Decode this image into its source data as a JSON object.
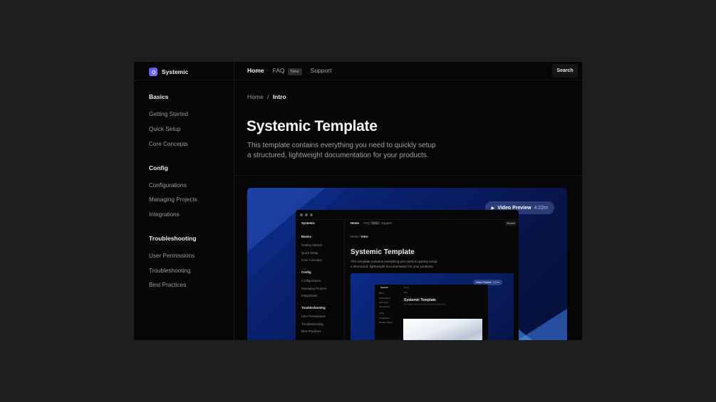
{
  "app": {
    "name": "Systemic"
  },
  "topnav": {
    "home": "Home",
    "faq": "FAQ",
    "faq_badge": "New",
    "support": "Support",
    "search": "Search"
  },
  "sidebar": {
    "groups": [
      {
        "title": "Basics",
        "items": [
          "Getting Started",
          "Quick Setup",
          "Core Concepts"
        ]
      },
      {
        "title": "Config",
        "items": [
          "Configurations",
          "Managing Projects",
          "Integrations"
        ]
      },
      {
        "title": "Troubleshooting",
        "items": [
          "User Permissions",
          "Troubleshooting",
          "Best Practices"
        ]
      }
    ]
  },
  "breadcrumb": {
    "root": "Home",
    "separator": "/",
    "current": "Intro"
  },
  "page": {
    "title": "Systemic Template",
    "description_line1": "This template contains everything you need to quickly setup",
    "description_line2": "a structured, lightweight documentation for your products."
  },
  "video": {
    "label": "Video Preview",
    "duration": "4:22m"
  },
  "colors": {
    "background": "#1e1e1e",
    "frame": "#060606",
    "accent": "#0a2a85"
  },
  "icons": {
    "logo": "systemic-logo-icon",
    "play": "play-icon"
  }
}
